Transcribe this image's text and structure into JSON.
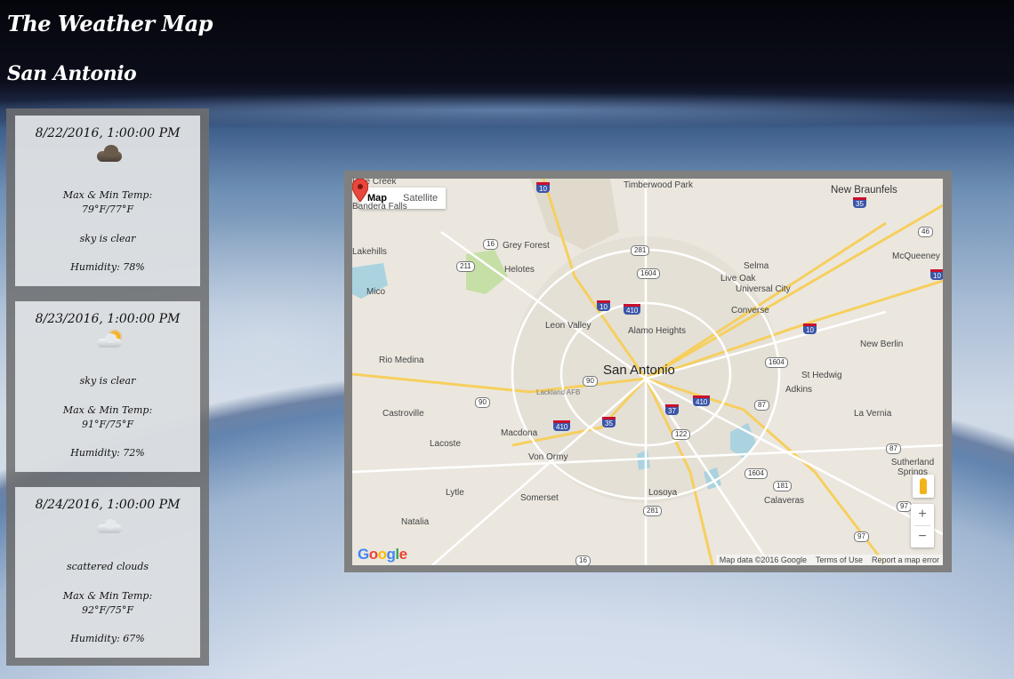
{
  "page": {
    "title": "The Weather Map",
    "city": "San Antonio"
  },
  "forecast": [
    {
      "date": "8/22/2016, 1:00:00 PM",
      "icon": "dark-cloud-icon",
      "lines": [
        "Max & Min Temp:",
        "79°F/77°F",
        "sky is clear",
        "Humidity: 78%"
      ]
    },
    {
      "date": "8/23/2016, 1:00:00 PM",
      "icon": "sun-cloud-icon",
      "lines": [
        "sky is clear",
        "Max & Min Temp:",
        "91°F/75°F",
        "Humidity: 72%"
      ]
    },
    {
      "date": "8/24/2016, 1:00:00 PM",
      "icon": "light-cloud-icon",
      "lines": [
        "scattered clouds",
        "Max & Min Temp:",
        "92°F/75°F",
        "Humidity: 67%"
      ]
    }
  ],
  "map": {
    "type_controls": {
      "map": "Map",
      "satellite": "Satellite"
    },
    "center_label": "San Antonio",
    "places": [
      "Timberwood Park",
      "New Braunfels",
      "Grey Forest",
      "Helotes",
      "Selma",
      "Live Oak",
      "Universal City",
      "McQueeney",
      "Converse",
      "Leon Valley",
      "Alamo Heights",
      "Rio Medina",
      "New Berlin",
      "St Hedwig",
      "Adkins",
      "Lackland AFB",
      "Castroville",
      "La Vernia",
      "Lacoste",
      "Macdona",
      "Von Ormy",
      "Sutherland Springs",
      "Lytle",
      "Somerset",
      "Losoya",
      "Calaveras",
      "Natalia",
      "Mico",
      "Lakehills",
      "Pipe Creek",
      "Bandera Falls"
    ],
    "highway_shields": [
      "10",
      "35",
      "46",
      "16",
      "281",
      "211",
      "1604",
      "410",
      "90",
      "37",
      "87",
      "122",
      "181",
      "97",
      "181"
    ],
    "zoom_in": "+",
    "zoom_out": "−",
    "logo": "Google",
    "attribution": [
      "Map data ©2016 Google",
      "Terms of Use",
      "Report a map error"
    ]
  }
}
